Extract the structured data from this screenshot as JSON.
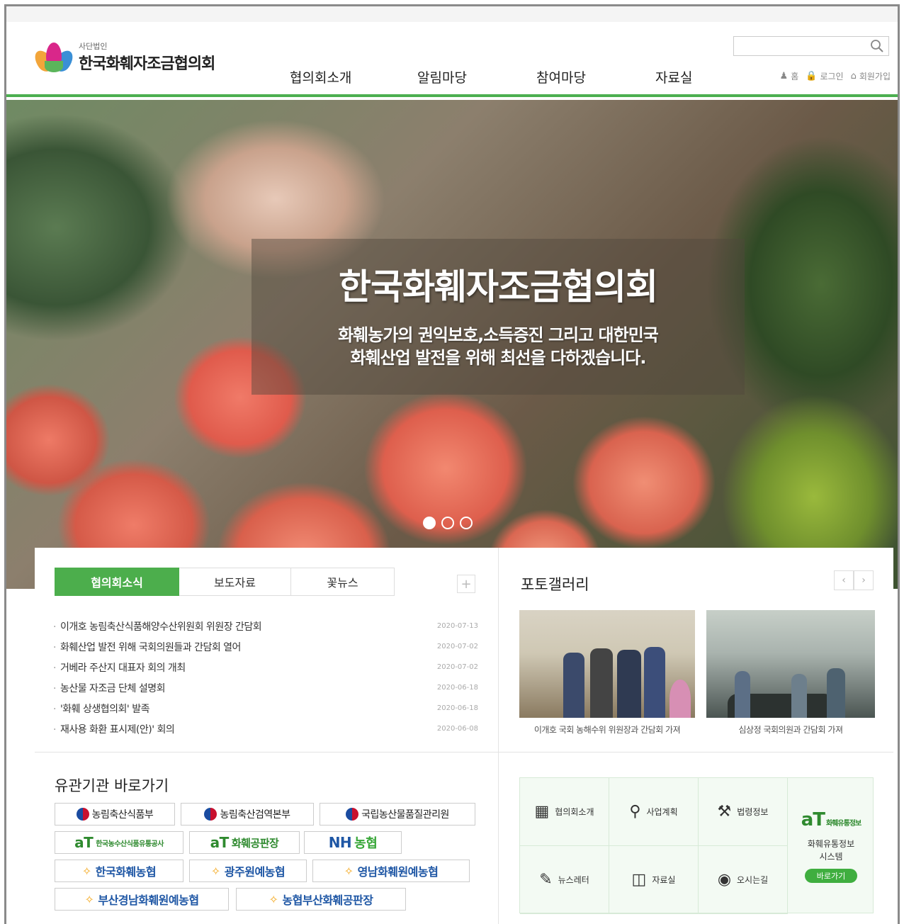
{
  "header": {
    "logo_sub": "사단법인",
    "logo_name": "한국화훼자조금협의회",
    "nav": [
      "협의회소개",
      "알림마당",
      "참여마당",
      "자료실"
    ],
    "search_placeholder": "",
    "util": [
      {
        "icon": "person-icon",
        "label": "홈"
      },
      {
        "icon": "lock-icon",
        "label": "로그인"
      },
      {
        "icon": "home-icon",
        "label": "회원가입"
      }
    ],
    "accent_color": "#4caf50"
  },
  "hero": {
    "title": "한국화훼자조금협의회",
    "line1": "화훼농가의 권익보호,소득증진 그리고 대한민국",
    "line2": "화훼산업 발전을 위해 최선을 다하겠습니다.",
    "slide_count": 3,
    "active_slide": 1
  },
  "news": {
    "tabs": [
      "협의회소식",
      "보도자료",
      "꽃뉴스"
    ],
    "more_label": "+",
    "items": [
      {
        "title": "이개호 농림축산식품해양수산위원회 위원장 간담회",
        "date": "2020-07-13"
      },
      {
        "title": "화훼산업 발전 위해 국회의원들과 간담회 열어",
        "date": "2020-07-02"
      },
      {
        "title": "거베라 주산지 대표자 회의 개최",
        "date": "2020-07-02"
      },
      {
        "title": "농산물 자조금 단체 설명회",
        "date": "2020-06-18"
      },
      {
        "title": "'화훼 상생협의회' 발족",
        "date": "2020-06-18"
      },
      {
        "title": "재사용 화환 표시제(안)' 회의",
        "date": "2020-06-08"
      }
    ]
  },
  "gallery": {
    "title": "포토갤러리",
    "prev": "‹",
    "next": "›",
    "captions": [
      "이개호 국회 농해수위 위원장과 간담회 가져",
      "심상정 국회의원과 간담회 가져"
    ]
  },
  "links": {
    "title": "유관기관 바로가기",
    "orgs": [
      {
        "label": "농림축산식품부"
      },
      {
        "label": "농림축산검역본부"
      },
      {
        "label": "국립농산물품질관리원"
      },
      {
        "mark": "aT",
        "label": "한국농수산식품유통공사"
      },
      {
        "mark": "aT",
        "label": "화훼공판장"
      },
      {
        "mark": "NH",
        "label": "농협"
      },
      {
        "label": "한국화훼농협"
      },
      {
        "label": "광주원예농협"
      },
      {
        "label": "영남화훼원예농협"
      },
      {
        "label": "부산경남화훼원예농협"
      },
      {
        "label": "농협부산화훼공판장"
      }
    ]
  },
  "quick": {
    "items": [
      {
        "icon": "building-icon",
        "label": "협의회소개"
      },
      {
        "icon": "lightbulb-icon",
        "label": "사업계획"
      },
      {
        "icon": "gavel-icon",
        "label": "법령정보"
      },
      {
        "icon": "newsletter-icon",
        "label": "뉴스레터"
      },
      {
        "icon": "book-icon",
        "label": "자료실"
      },
      {
        "icon": "location-icon",
        "label": "오시는길"
      }
    ],
    "side": {
      "logo": "aT",
      "logo_small": "화훼유통정보",
      "line1": "화훼유통정보",
      "line2": "시스템",
      "button": "바로가기"
    }
  }
}
